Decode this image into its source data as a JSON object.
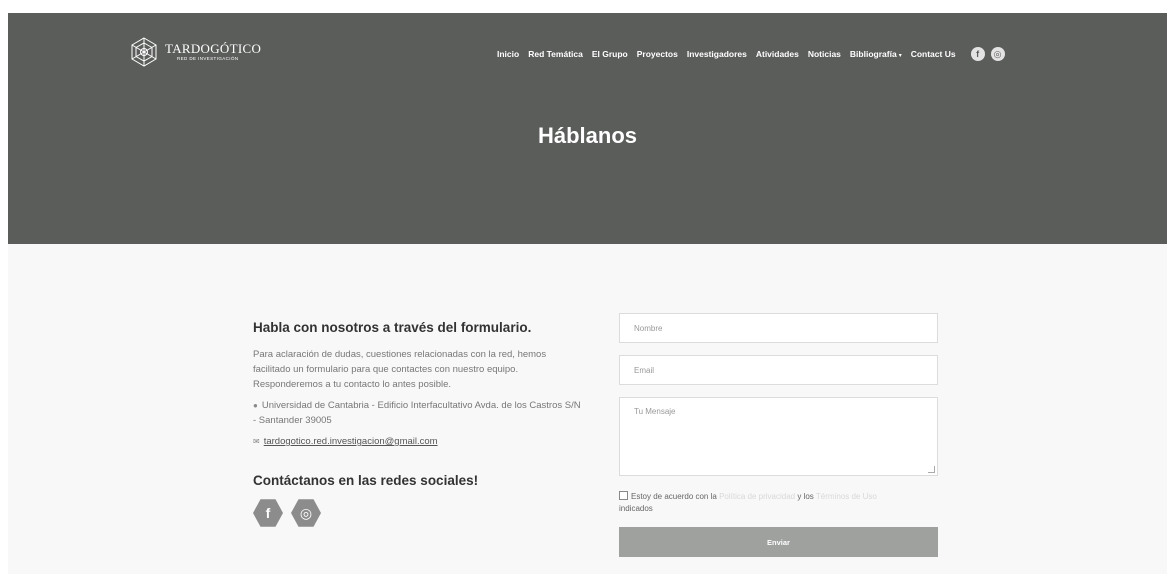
{
  "brand": {
    "title": "TARDOGÓTICO",
    "subtitle": "RED DE INVESTIGACIÓN"
  },
  "nav": {
    "items": [
      "Inicio",
      "Red Temática",
      "El Grupo",
      "Proyectos",
      "Investigadores",
      "Atividades",
      "Noticias",
      "Bibliografía",
      "Contact Us"
    ],
    "caret": "▾",
    "facebook": "f",
    "instagram": "◎"
  },
  "hero": {
    "title": "Háblanos"
  },
  "contact": {
    "heading": "Habla con nosotros a través del formulario.",
    "description": "Para aclaración de dudas, cuestiones relacionadas con la red, hemos facilitado un formulario para que contactes con nuestro equipo. Responderemos a tu contacto lo antes posible.",
    "address": "Universidad de Cantabria - Edificio Interfacultativo Avda. de los Castros S/N - Santander 39005",
    "email": "tardogotico.red.investigacion@gmail.com",
    "social_heading": "Contáctanos en las redes sociales!",
    "facebook": "f",
    "instagram": "◎"
  },
  "form": {
    "name_placeholder": "Nombre",
    "email_placeholder": "Email",
    "message_placeholder": "Tu Mensaje",
    "agree_prefix": "Estoy de acuerdo con la",
    "privacy_link": "Política de privacidad",
    "agree_middle": "y los",
    "terms_link": "Términos de Uso",
    "agree_suffix": "indicados",
    "submit": "Enviar"
  }
}
